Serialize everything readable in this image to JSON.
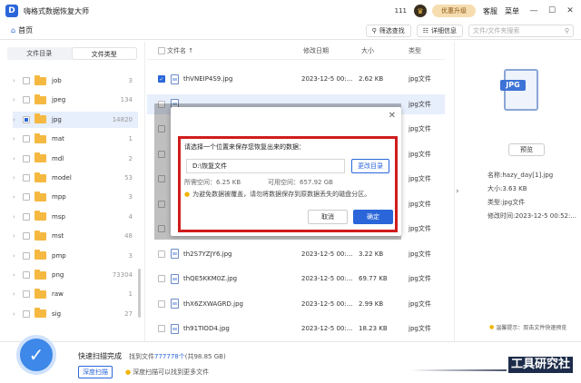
{
  "app": {
    "title": "嗨格式数据恢复大师",
    "count": "111",
    "upgrade": "优惠升级",
    "service": "客服",
    "menu": "菜单"
  },
  "window": {
    "minimize": "—",
    "maximize": "☐",
    "close": "✕"
  },
  "nav": {
    "home": "首页",
    "filter": "筛选查找",
    "details": "详细信息",
    "search_placeholder": "文件/文件夹搜索"
  },
  "sidebar": {
    "tabs": [
      "文件目录",
      "文件类型"
    ],
    "items": [
      {
        "name": "job",
        "count": "3"
      },
      {
        "name": "jpeg",
        "count": "134"
      },
      {
        "name": "jpg",
        "count": "14820"
      },
      {
        "name": "mat",
        "count": "1"
      },
      {
        "name": "mdl",
        "count": "2"
      },
      {
        "name": "model",
        "count": "53"
      },
      {
        "name": "mpp",
        "count": "3"
      },
      {
        "name": "msp",
        "count": "4"
      },
      {
        "name": "mst",
        "count": "48"
      },
      {
        "name": "pmp",
        "count": "3"
      },
      {
        "name": "png",
        "count": "73304"
      },
      {
        "name": "raw",
        "count": "1"
      },
      {
        "name": "sig",
        "count": "27"
      }
    ]
  },
  "filelist": {
    "headers": {
      "name": "文件名",
      "date": "修改日期",
      "size": "大小",
      "type": "类型"
    },
    "rows": [
      {
        "name": "thVNEIP4S9.jpg",
        "date": "2023-12-5 00:...",
        "size": "2.62 KB",
        "type": "jpg文件",
        "checked": true
      },
      {
        "name": "",
        "date": "",
        "size": "",
        "type": "jpg文件",
        "checked": false
      },
      {
        "name": "",
        "date": "",
        "size": "",
        "type": "jpg文件",
        "checked": false
      },
      {
        "name": "",
        "date": "",
        "size": "",
        "type": "jpg文件",
        "checked": false
      },
      {
        "name": "",
        "date": "",
        "size": "",
        "type": "jpg文件",
        "checked": false
      },
      {
        "name": "",
        "date": "",
        "size": "",
        "type": "jpg文件",
        "checked": false
      },
      {
        "name": "",
        "date": "",
        "size": "",
        "type": "jpg文件",
        "checked": false
      },
      {
        "name": "th2S7YZJY6.jpg",
        "date": "2023-12-5 00:...",
        "size": "3.22 KB",
        "type": "jpg文件",
        "checked": false
      },
      {
        "name": "thQE5KKM0Z.jpg",
        "date": "2023-12-5 00:...",
        "size": "69.77 KB",
        "type": "jpg文件",
        "checked": false
      },
      {
        "name": "thX6ZXWAGRD.jpg",
        "date": "2023-12-5 00:...",
        "size": "2.99 KB",
        "type": "jpg文件",
        "checked": false
      },
      {
        "name": "th91TIOD4.jpg",
        "date": "2023-12-5 00:...",
        "size": "18.23 KB",
        "type": "jpg文件",
        "checked": false
      }
    ]
  },
  "preview": {
    "badge": "JPG",
    "button": "预览",
    "name": "名称:hazy_day[1].jpg",
    "size": "大小:3.63 KB",
    "type": "类型:jpg文件",
    "modified": "修改时间:2023-12-5 00:52:...",
    "tip": "温馨提示：双击文件快速预览"
  },
  "bottom": {
    "done": "快速扫描完成",
    "found_prefix": "找到文件",
    "found_count": "777778个",
    "found_size": "(共98.85 GB)",
    "deep_scan": "深度扫描",
    "deep_tip": "深度扫描可以找到更多文件",
    "watermark": "工具研究社"
  },
  "modal": {
    "title": "请选择一个位置来保存您恢复出来的数据：",
    "path": "D:\\恢复文件",
    "change": "更改目录",
    "required": "所需空间：6.25 KB",
    "available": "可用空间：657.92 GB",
    "warning": "为避免数据被覆盖，请勿将数据保存到原数据丢失的磁盘分区。",
    "cancel": "取消",
    "ok": "确定"
  }
}
